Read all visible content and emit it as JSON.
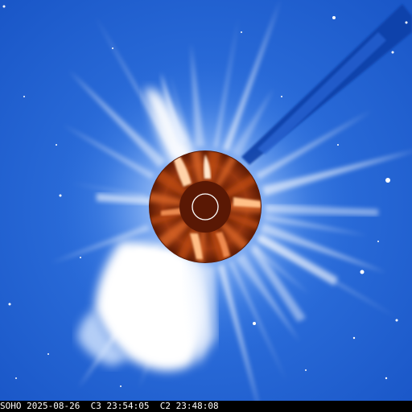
{
  "caption": {
    "observatory": "SOHO",
    "date": "2025-08-26",
    "c3_time": "C3 23:54:05",
    "c2_time": "C2 23:48:08"
  },
  "colors": {
    "sky": "#1d5fd0",
    "corona_white": "#ffffff",
    "c2_disk": "#7a2a08",
    "c2_bright": "#ff9a55",
    "occulter": "#5a1804",
    "sun_outline": "#ffffff"
  },
  "icons": {
    "occulter": "sun-outline-icon"
  }
}
